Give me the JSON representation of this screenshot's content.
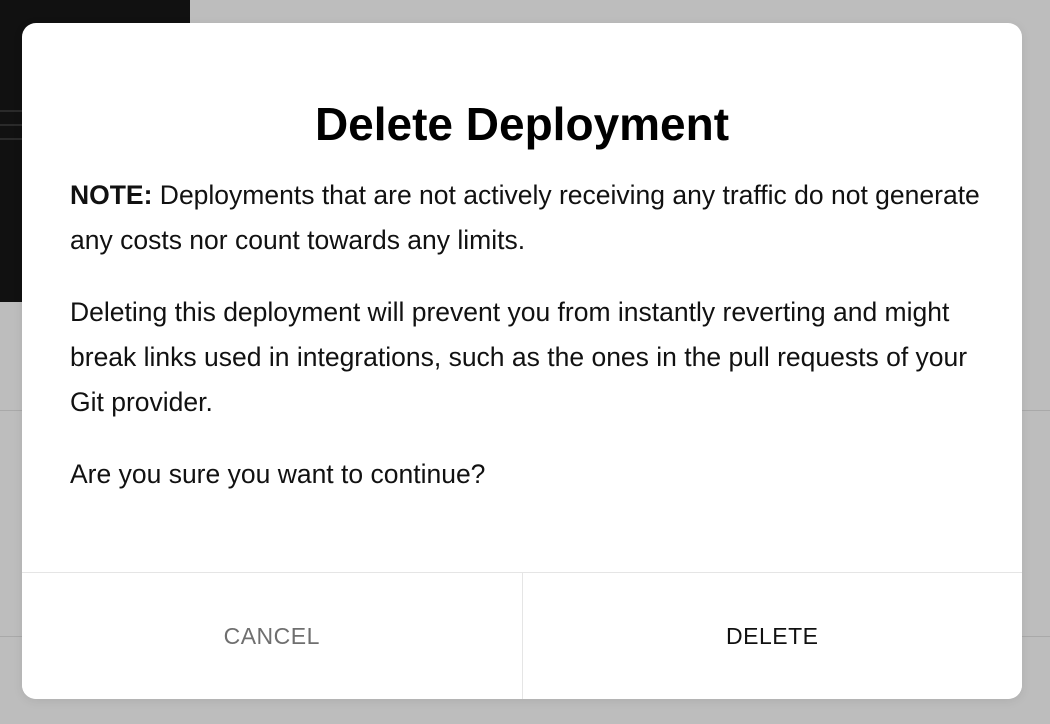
{
  "dialog": {
    "title": "Delete Deployment",
    "note_label": "NOTE:",
    "note_text": " Deployments that are not actively receiving any traffic do not generate any costs nor count towards any limits.",
    "warning_text": "Deleting this deployment will prevent you from instantly reverting and might break links used in integrations, such as the ones in the pull requests of your Git provider.",
    "question_text": "Are you sure you want to continue?",
    "cancel_label": "CANCEL",
    "delete_label": "DELETE"
  },
  "colors": {
    "overlay": "#bdbdbd",
    "modal_background": "#ffffff",
    "cancel_text": "#6f6f6f",
    "delete_text": "#111111",
    "divider": "#e5e5e5"
  }
}
